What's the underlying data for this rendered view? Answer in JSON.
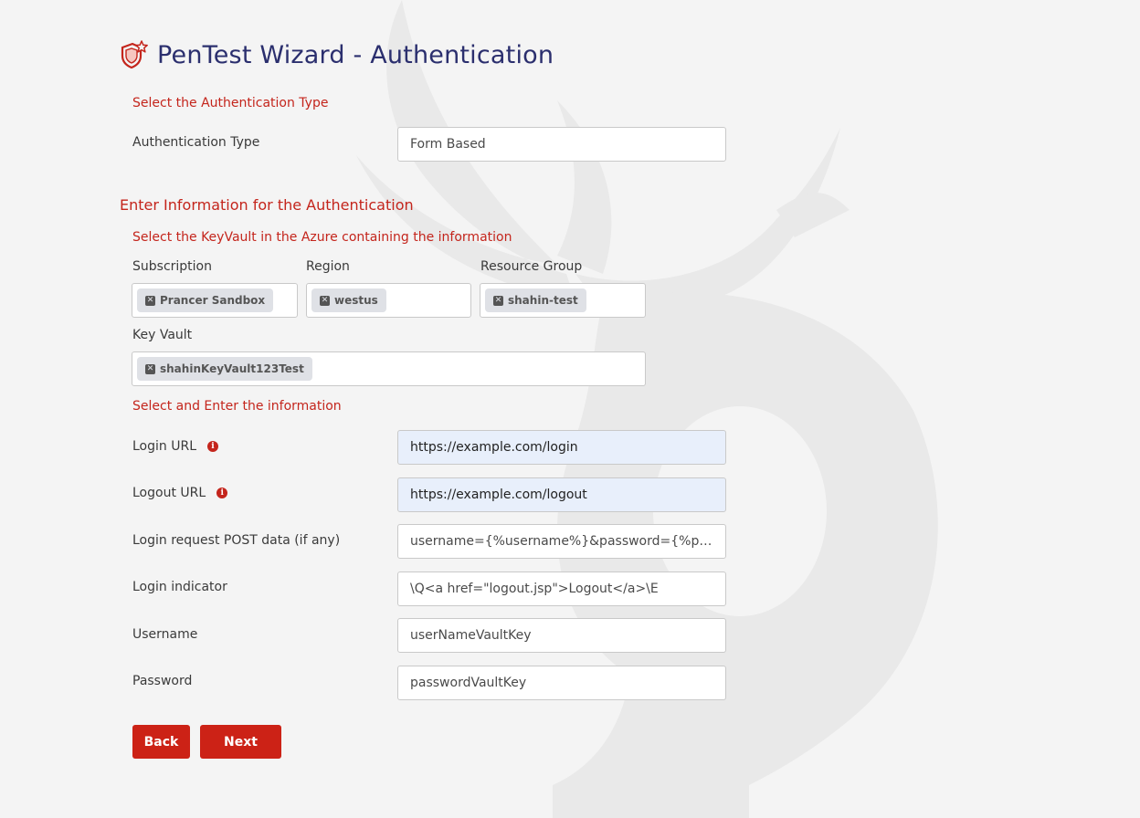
{
  "page": {
    "title": "PenTest Wizard - Authentication"
  },
  "auth_type_section": {
    "label": "Select the Authentication Type",
    "field_label": "Authentication Type",
    "value": "Form Based"
  },
  "info_section": {
    "heading": "Enter Information for the Authentication",
    "keyvault_label": "Select the KeyVault in the Azure containing the information",
    "subscription": {
      "label": "Subscription",
      "tag": "Prancer Sandbox"
    },
    "region": {
      "label": "Region",
      "tag": "westus"
    },
    "resource_group": {
      "label": "Resource Group",
      "tag": "shahin-test"
    },
    "key_vault": {
      "label": "Key Vault",
      "tag": "shahinKeyVault123Test"
    }
  },
  "details_section": {
    "label": "Select and Enter the information",
    "login_url": {
      "label": "Login URL",
      "value": "https://example.com/login"
    },
    "logout_url": {
      "label": "Logout URL",
      "value": "https://example.com/logout"
    },
    "post_data": {
      "label": "Login request POST data (if any)",
      "value": "username={%username%}&password={%password%}"
    },
    "login_indicator": {
      "label": "Login indicator",
      "value": "\\Q<a href=\"logout.jsp\">Logout</a>\\E"
    },
    "username": {
      "label": "Username",
      "value": "userNameVaultKey"
    },
    "password": {
      "label": "Password",
      "value": "passwordVaultKey"
    }
  },
  "buttons": {
    "back": "Back",
    "next": "Next"
  },
  "icons": {
    "logo": "shield-star-icon",
    "info": "info-icon",
    "remove": "close-icon",
    "watermark": "antler-watermark-icon"
  },
  "colors": {
    "accent": "#cc2216",
    "title": "#2b2f6e",
    "autofill": "#e8effb"
  }
}
